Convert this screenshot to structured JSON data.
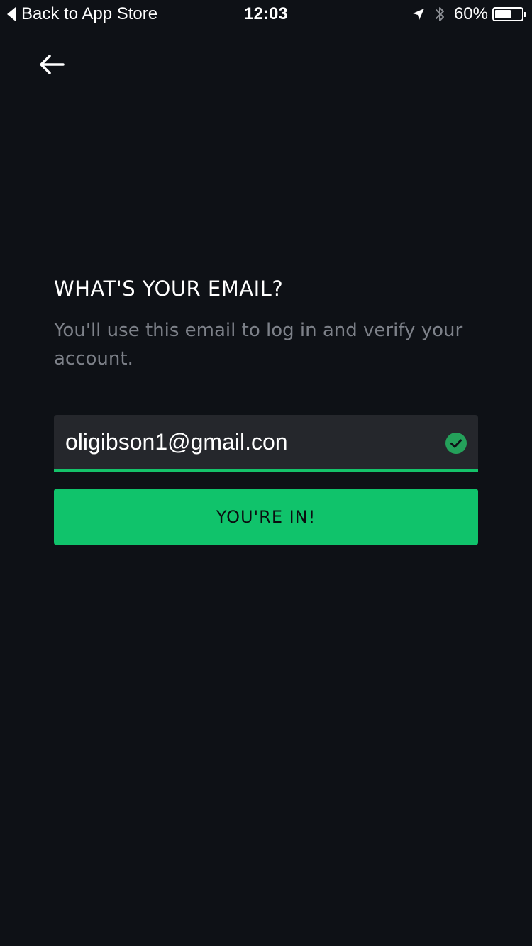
{
  "status_bar": {
    "back_label": "Back to App Store",
    "time": "12:03",
    "battery_percent_label": "60%",
    "battery_level": 0.6,
    "icons": [
      "location-arrow-icon",
      "bluetooth-icon",
      "battery-icon"
    ]
  },
  "nav": {
    "back_icon": "arrow-left-icon"
  },
  "form": {
    "title": "WHAT'S YOUR EMAIL?",
    "subtitle": "You'll use this email to log in and verify your account.",
    "email_value": "oligibson1@gmail.con",
    "valid_icon": "check-circle-icon",
    "submit_label": "YOU'RE IN!"
  },
  "colors": {
    "background": "#0e1116",
    "accent_green": "#10c36b",
    "field_background": "#25272c",
    "subtitle_text": "#7d8189"
  }
}
